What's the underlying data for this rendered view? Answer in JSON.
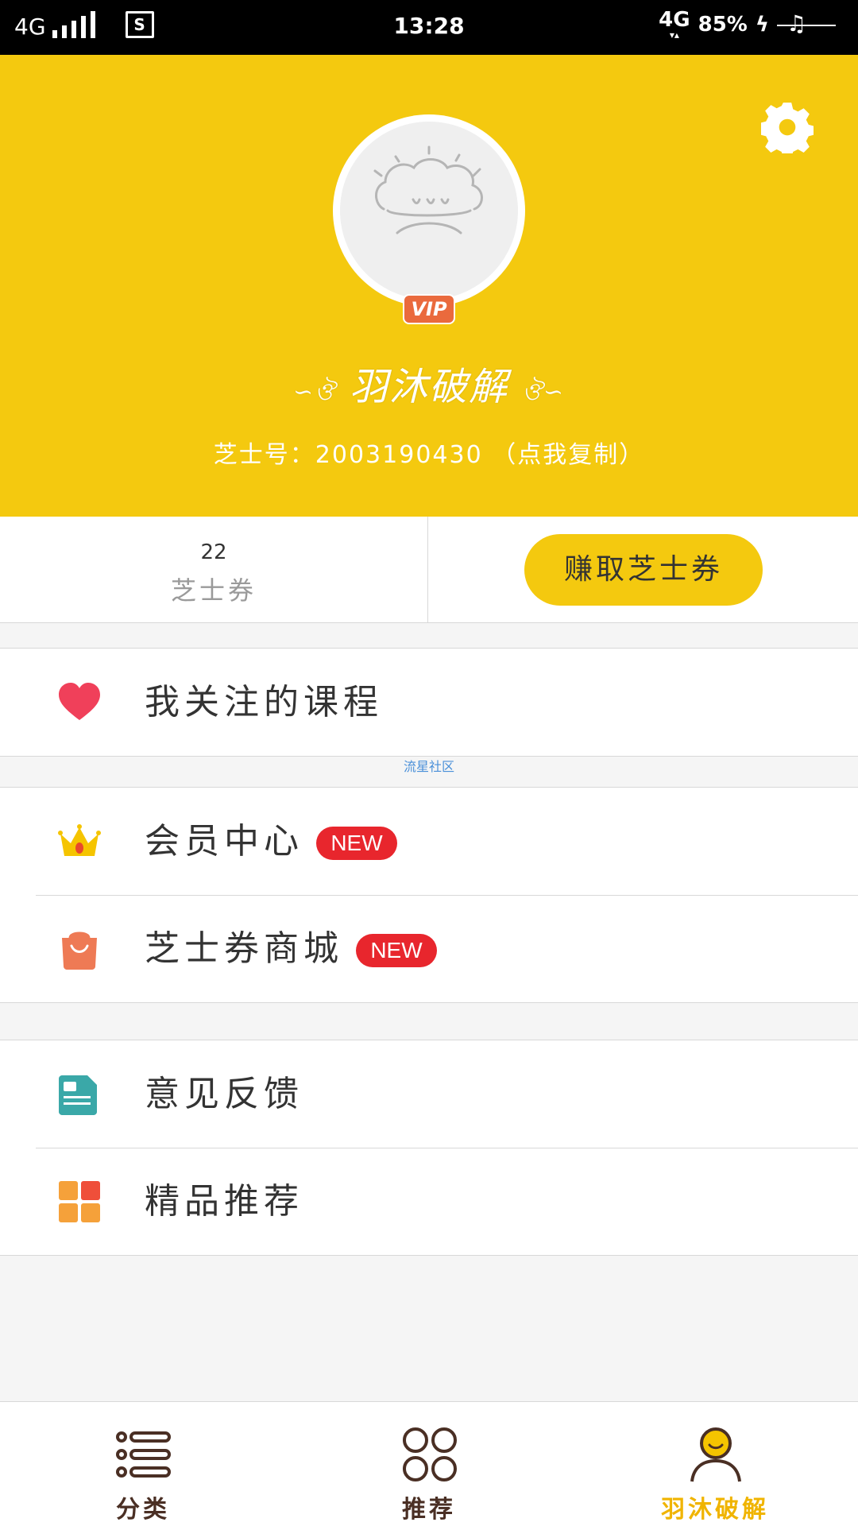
{
  "status_bar": {
    "network": "4G",
    "time": "13:28",
    "network_right": "4G",
    "battery": "85%"
  },
  "profile": {
    "vip_badge": "VIP",
    "nickname": "羽沐破解",
    "uid_line": "芝士号：2003190430 （点我复制）"
  },
  "stats": {
    "coupon_count": "22",
    "coupon_label": "芝士券",
    "earn_button": "赚取芝士券"
  },
  "menu": {
    "followed_courses": "我关注的课程",
    "member_center": "会员中心",
    "coupon_mall": "芝士券商城",
    "new_badge": "NEW",
    "feedback": "意见反馈",
    "recommend": "精品推荐"
  },
  "watermark": "流星社区",
  "tabs": [
    {
      "label": "分类",
      "icon": "list-icon"
    },
    {
      "label": "推荐",
      "icon": "grid-icon"
    },
    {
      "label": "羽沐破解",
      "icon": "user-icon",
      "active": true
    }
  ],
  "colors": {
    "brand_yellow": "#f4c90f",
    "vip_orange": "#ea6a3d",
    "new_red": "#e8262d",
    "heart_red": "#f0405a",
    "tab_active": "#f0b400",
    "tab_inactive": "#4a2f24"
  }
}
